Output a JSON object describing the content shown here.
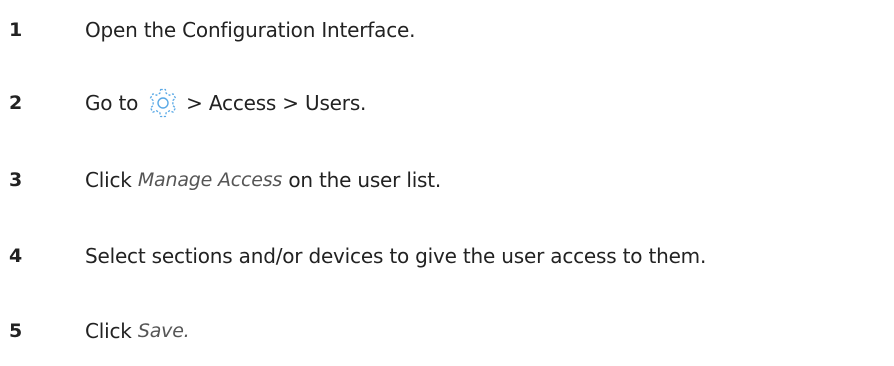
{
  "steps": [
    {
      "number": "1",
      "text": "Open the Configuration Interface."
    },
    {
      "number": "2",
      "before_icon": "Go to",
      "icon": "gear-icon",
      "after_icon": "> Access > Users."
    },
    {
      "number": "3",
      "before": "Click",
      "italic": "Manage Access",
      "after": "on the user list."
    },
    {
      "number": "4",
      "text": "Select sections and/or devices to give the user access to them."
    },
    {
      "number": "5",
      "before": "Click",
      "italic": "Save."
    }
  ],
  "colors": {
    "text": "#222222",
    "italic_text": "#555555",
    "gear_icon": "#5aa9e6"
  }
}
